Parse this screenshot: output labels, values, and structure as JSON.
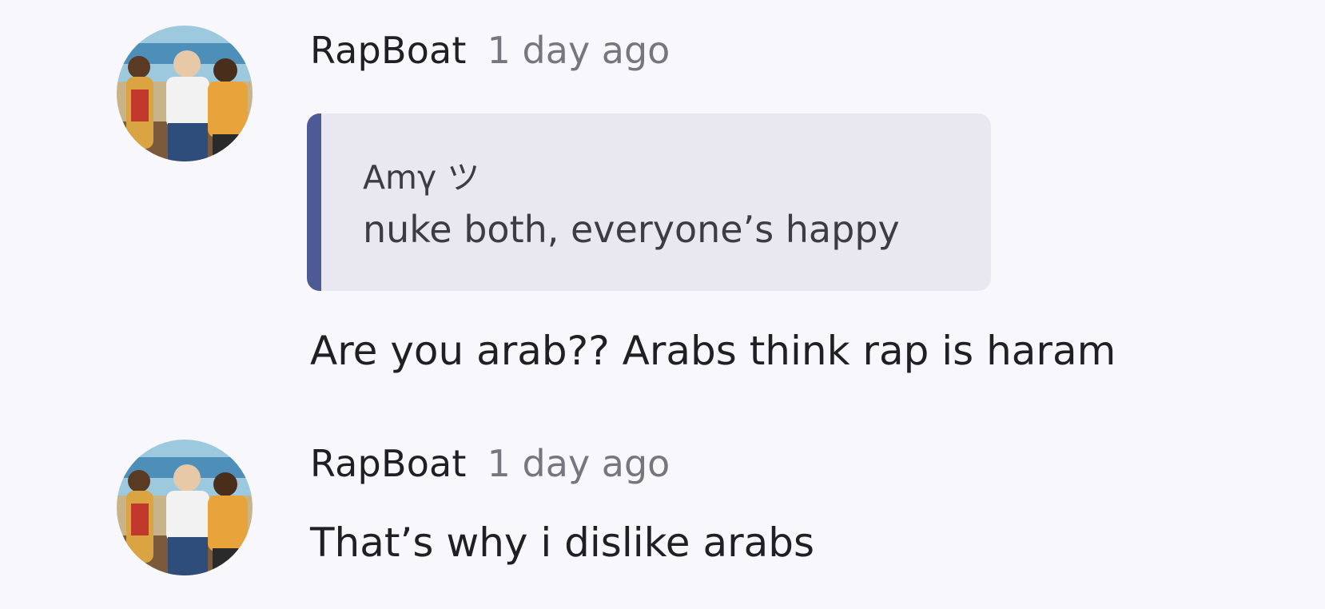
{
  "messages": [
    {
      "username": "RapBoat",
      "timestamp": "1 day ago",
      "quote": {
        "author": "Amγ ツ",
        "text": "nuke both, everyone’s happy"
      },
      "text": "Are you arab?? Arabs think rap is haram"
    },
    {
      "username": "RapBoat",
      "timestamp": "1 day ago",
      "text": "That’s why i dislike arabs"
    }
  ],
  "colors": {
    "background": "#f8f7fc",
    "quote_background": "#e9e8f0",
    "quote_accent": "#4e5a96",
    "timestamp": "#77767f"
  }
}
